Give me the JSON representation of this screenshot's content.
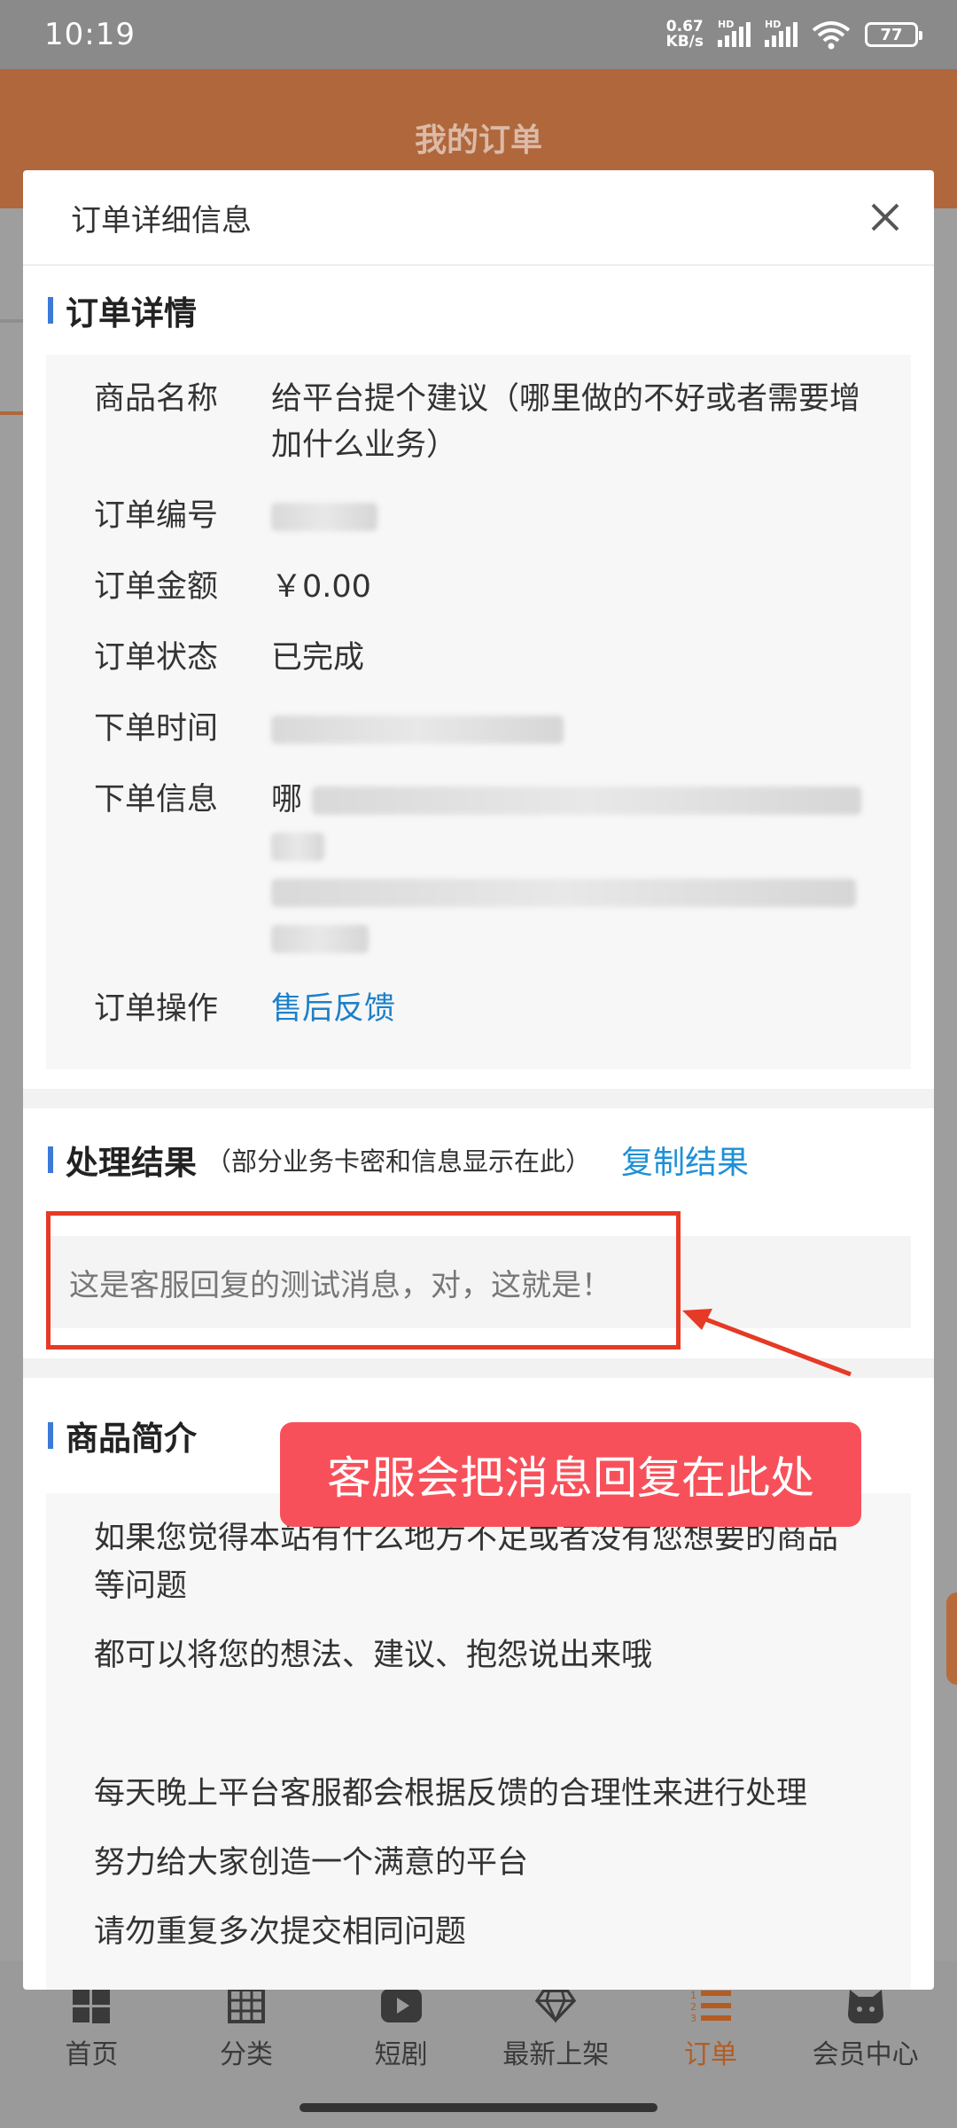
{
  "status_bar": {
    "time": "10:19",
    "net_speed_value": "0.67",
    "net_speed_unit": "KB/s",
    "hd1": "HD",
    "hd2": "HD",
    "battery": "77"
  },
  "page": {
    "title": "我的订单"
  },
  "modal": {
    "title": "订单详细信息",
    "order_section": {
      "title": "订单详情",
      "rows": [
        {
          "label": "商品名称",
          "value": "给平台提个建议（哪里做的不好或者需要增加什么业务）"
        },
        {
          "label": "订单编号",
          "value": ""
        },
        {
          "label": "订单金额",
          "value": "￥0.00"
        },
        {
          "label": "订单状态",
          "value": "已完成"
        },
        {
          "label": "下单时间",
          "value": ""
        },
        {
          "label": "下单信息",
          "value": "哪"
        },
        {
          "label": "订单操作",
          "value": "售后反馈"
        }
      ]
    },
    "result_section": {
      "title": "处理结果",
      "subtitle": "（部分业务卡密和信息显示在此）",
      "copy_label": "复制结果",
      "content": "这是客服回复的测试消息，对，这就是！"
    },
    "annotation": {
      "callout": "客服会把消息回复在此处",
      "highlight_color": "#e53a25",
      "callout_color": "#f8505a"
    },
    "intro_section": {
      "title": "商品简介",
      "lines": [
        "如果您觉得本站有什么地方不足或者没有您想要的商品等问题",
        "都可以将您的想法、建议、抱怨说出来哦",
        "",
        "每天晚上平台客服都会根据反馈的合理性来进行处理",
        "努力给大家创造一个满意的平台",
        "请勿重复多次提交相同问题"
      ]
    }
  },
  "bottom_nav": {
    "items": [
      {
        "label": "首页",
        "icon": "windows-grid-icon"
      },
      {
        "label": "分类",
        "icon": "table-grid-icon"
      },
      {
        "label": "短剧",
        "icon": "play-video-icon"
      },
      {
        "label": "最新上架",
        "icon": "diamond-icon"
      },
      {
        "label": "订单",
        "icon": "list-numbered-icon",
        "active": true
      },
      {
        "label": "会员中心",
        "icon": "cat-avatar-icon"
      }
    ]
  },
  "colors": {
    "accent": "#b45c22",
    "link": "#1e90d6",
    "section_bar": "#3b7ad8"
  }
}
